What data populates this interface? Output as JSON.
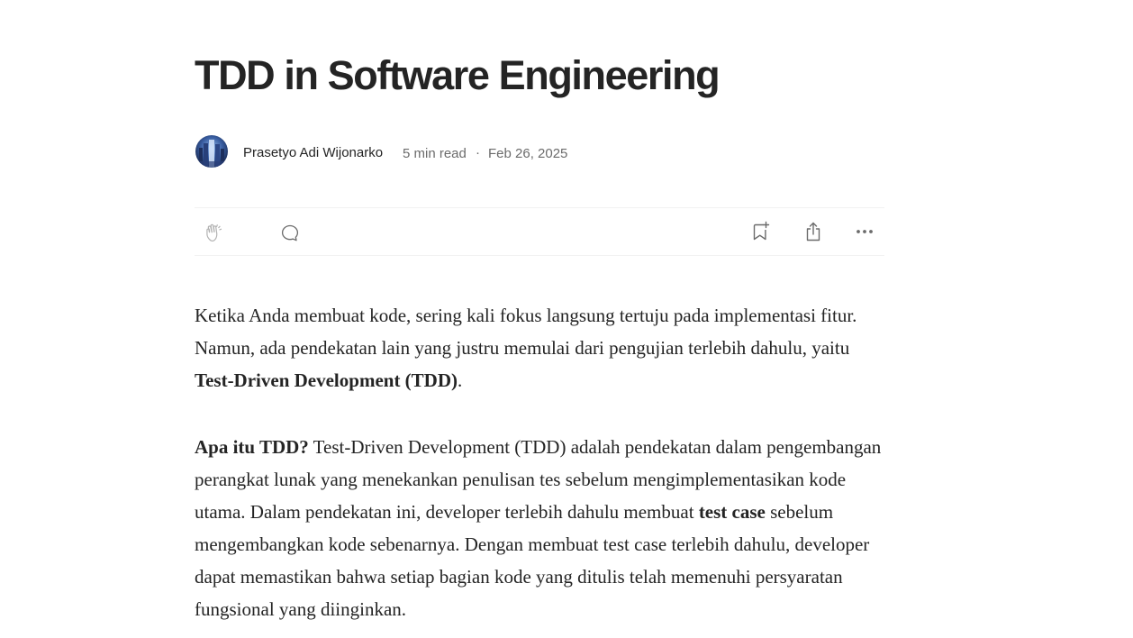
{
  "article": {
    "title": "TDD in Software Engineering",
    "author": "Prasetyo Adi Wijonarko",
    "read_time": "5 min read",
    "separator": "·",
    "date": "Feb 26, 2025"
  },
  "actions": {
    "clap_icon": "clap-icon",
    "comment_icon": "comment-bubble-icon",
    "save_icon": "bookmark-add-icon",
    "share_icon": "share-icon",
    "more_icon": "more-horizontal-icon"
  },
  "paragraphs": {
    "p1": {
      "text_before": "Ketika Anda membuat kode, sering kali fokus langsung tertuju pada implementasi fitur. Namun, ada pendekatan lain yang justru memulai dari pengujian terlebih dahulu, yaitu ",
      "bold": "Test-Driven Development (TDD)",
      "text_after": "."
    },
    "p2": {
      "bold_lead": "Apa itu TDD?",
      "text_1": " Test-Driven Development (TDD) adalah pendekatan dalam pengembangan perangkat lunak yang menekankan penulisan tes sebelum mengimplementasikan kode utama. Dalam pendekatan ini, developer terlebih dahulu membuat ",
      "bold_mid": "test case",
      "text_2": " sebelum mengembangkan kode sebenarnya. Dengan membuat test case terlebih dahulu, developer dapat memastikan bahwa setiap bagian kode yang ditulis telah memenuhi persyaratan fungsional yang diinginkan."
    }
  },
  "colors": {
    "text": "#242424",
    "muted": "#6b6b6b",
    "divider": "#f2f2f2",
    "icon": "#6b6b6b"
  }
}
